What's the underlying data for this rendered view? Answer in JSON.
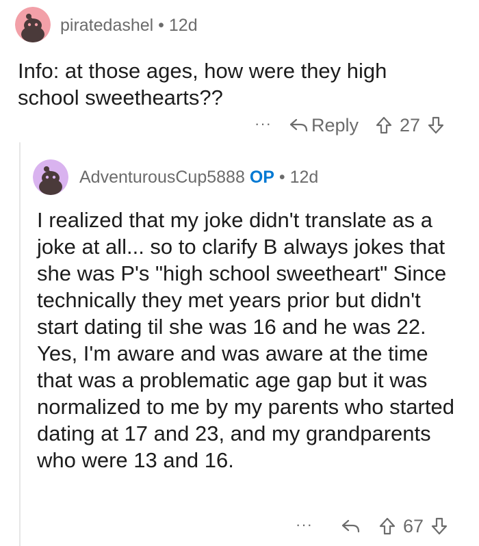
{
  "comments": [
    {
      "username": "piratedashel",
      "separator": "•",
      "age": "12d",
      "text": "Info: at those ages, how were they high school sweethearts??",
      "more_label": "···",
      "reply_label": "Reply",
      "votes": "27",
      "avatar_color": "#f2a0a8"
    },
    {
      "username": "AdventurousCup5888",
      "op_badge": "OP",
      "separator": "•",
      "age": "12d",
      "text": "I realized that my joke didn't translate as a joke at all... so to clarify B always jokes that she was P's \"high school sweetheart\" Since technically they met years prior but didn't start dating til she was 16 and he was 22. Yes, I'm aware and was aware at the time that was a problematic age gap but it was normalized to me by my parents who started dating at 17 and 23, and my grandparents who were 13 and 16.",
      "more_label": "···",
      "votes": "67",
      "avatar_color": "#d9b3ef"
    }
  ]
}
